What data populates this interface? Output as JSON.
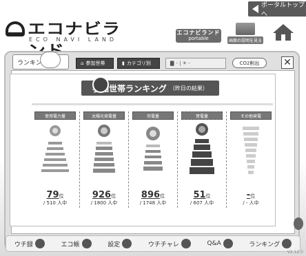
{
  "header": {
    "portal_link": "ポータルトップへ",
    "logo_text": "エコナビランド",
    "logo_sub": "ECO NAVI LAND",
    "portable_top": "エコナビランド",
    "portable_bottom": "portable",
    "desc_button": "画面の説明を見る"
  },
  "tabs": {
    "ranking_label": "ランキング",
    "participants": "参加世帯",
    "category": "カテゴリ別",
    "filter_text": "- | ☀ -",
    "co2": "CO2削出"
  },
  "title": {
    "main": "参加世帯ランキング",
    "sub": "（昨日の結果）"
  },
  "columns": [
    {
      "label": "使用電力量",
      "rank": "79",
      "rank_unit": "位",
      "total": "/ 510 人中"
    },
    {
      "label": "太陽光発電量",
      "rank": "926",
      "rank_unit": "位",
      "total": "/ 1800 人中"
    },
    {
      "label": "売電量",
      "rank": "896",
      "rank_unit": "位",
      "total": "/ 1748 人中"
    },
    {
      "label": "買電量",
      "rank": "51",
      "rank_unit": "位",
      "total": "/ 607 人中"
    },
    {
      "label": "その他発電",
      "rank": "-",
      "rank_unit": "位",
      "total": "/ - 人中"
    }
  ],
  "bottom_nav": {
    "items": [
      "ウチ録",
      "エコ帳",
      "設定",
      "ウチチャレ",
      "Q&A",
      "ランキング"
    ]
  },
  "version": "V2.12.0"
}
